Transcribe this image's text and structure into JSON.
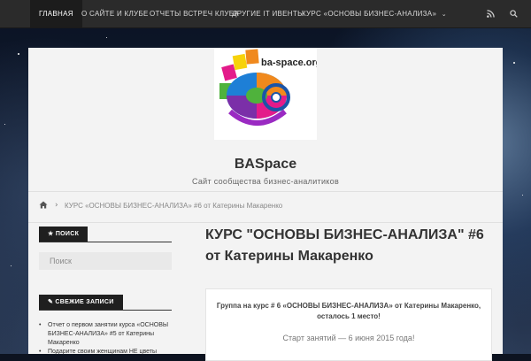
{
  "nav": {
    "items": [
      {
        "label": "ГЛАВНАЯ",
        "active": true
      },
      {
        "label": "О САЙТЕ И КЛУБЕ",
        "active": false
      },
      {
        "label": "ОТЧЕТЫ ВСТРЕЧ КЛУБА",
        "active": false
      },
      {
        "label": "ДРУГИЕ IT ИВЕНТЫ",
        "active": false
      },
      {
        "label": "КУРС «ОСНОВЫ БИЗНЕС-АНАЛИЗА»",
        "active": false,
        "has_dropdown": true
      }
    ],
    "right_icons": [
      "rss-icon",
      "search-icon"
    ]
  },
  "header": {
    "logo_text": "ba-space.org",
    "site_title": "BASpace",
    "site_description": "Сайт сообщества бизнес-аналитиков"
  },
  "breadcrumb": {
    "current": "КУРС «ОСНОВЫ БИЗНЕС-АНАЛИЗА» #6 от Катерины Макаренко"
  },
  "sidebar": {
    "search": {
      "title": "ПОИСК",
      "placeholder": "Поиск"
    },
    "recent": {
      "title": "СВЕЖИЕ ЗАПИСИ",
      "items": [
        "Отчет о первом занятии курса «ОСНОВЫ БИЗНЕС-АНАЛИЗА» #5 от Катерины Макаренко",
        "Подарите своим женщинам НЕ цветы"
      ]
    }
  },
  "article": {
    "title": "КУРС \"ОСНОВЫ БИЗНЕС-АНАЛИЗА\" #6 от Катерины Макаренко",
    "lead": "Группа на курс # 6 «ОСНОВЫ БИЗНЕС-АНАЛИЗА» от Катерины Макаренко, осталось 1 место!",
    "date_line": "Старт занятий — 6 июня 2015 года!"
  },
  "colors": {
    "nav_bg": "#2b2b2b",
    "panel_bg": "#f3f3f3",
    "widget_title_bg": "#1f1f1f",
    "text_dark": "#333333"
  }
}
